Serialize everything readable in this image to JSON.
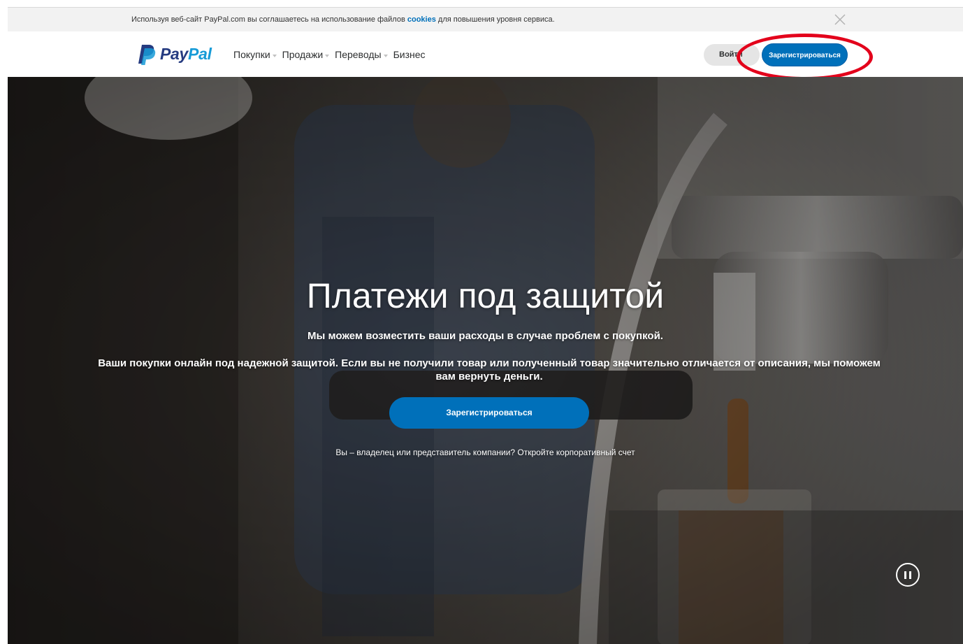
{
  "cookie_bar": {
    "text_before": "Используя веб-сайт PayPal.com вы соглашаетесь на использование файлов ",
    "link": "cookies",
    "text_after": " для повышения уровня сервиса."
  },
  "header": {
    "brand": {
      "part1": "Pay",
      "part2": "Pal"
    },
    "nav": [
      {
        "label": "Покупки",
        "dropdown": true
      },
      {
        "label": "Продажи",
        "dropdown": true
      },
      {
        "label": "Переводы",
        "dropdown": true
      },
      {
        "label": "Бизнес",
        "dropdown": false
      }
    ],
    "login_label": "Войти",
    "signup_label": "Зарегистрироваться"
  },
  "hero": {
    "title": "Платежи под защитой",
    "subtitle": "Мы можем возместить ваши расходы в случае проблем с покупкой.",
    "description": "Ваши покупки онлайн под надежной защитой. Если вы не получили товар или полученный товар значительно отличается от описания, мы поможем вам вернуть деньги.",
    "cta_label": "Зарегистрироваться",
    "business_link": "Вы – владелец или представитель компании? Откройте корпоративный счет"
  },
  "colors": {
    "brand_blue": "#0070ba",
    "paypal_dark": "#253b80",
    "paypal_light": "#179bd7",
    "annotation_red": "#e3001b"
  },
  "icons": {
    "close": "close-icon",
    "caret": "chevron-down-icon",
    "pause": "pause-icon"
  }
}
